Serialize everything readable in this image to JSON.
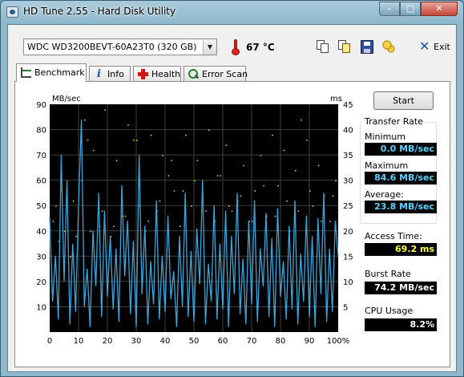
{
  "window": {
    "title": "HD Tune 2.55 - Hard Disk Utility"
  },
  "titlebar": {
    "minimize": "–",
    "maximize": "□",
    "close": "✕"
  },
  "toolbar": {
    "drive": "WDC WD3200BEVT-60A23T0 (320 GB)",
    "temperature": "67 °C",
    "exit_label": "Exit",
    "icons": [
      "copy-text-icon",
      "copy-screenshot-icon",
      "save-icon",
      "options-icon",
      "exit-icon",
      "thermometer-icon"
    ]
  },
  "tabs": [
    {
      "label": "Benchmark",
      "icon": "benchmark-icon",
      "active": true
    },
    {
      "label": "Info",
      "icon": "info-icon",
      "active": false
    },
    {
      "label": "Health",
      "icon": "health-icon",
      "active": false
    },
    {
      "label": "Error Scan",
      "icon": "error-scan-icon",
      "active": false
    }
  ],
  "benchmark": {
    "start_label": "Start",
    "transfer_rate_title": "Transfer Rate",
    "minimum_label": "Minimum",
    "minimum_value": "0.0 MB/sec",
    "maximum_label": "Maximum",
    "maximum_value": "84.6 MB/sec",
    "average_label": "Average:",
    "average_value": "23.8 MB/sec",
    "access_time_label": "Access Time:",
    "access_time_value": "69.2 ms",
    "burst_rate_label": "Burst Rate",
    "burst_rate_value": "74.2 MB/sec",
    "cpu_usage_label": "CPU Usage",
    "cpu_usage_value": "8.2%"
  },
  "colors": {
    "transfer_line": "#3aa6dc",
    "access_points": "#e6e64a",
    "grid": "#3f3f3f",
    "background": "#000000"
  },
  "chart_data": {
    "type": "line",
    "title": "",
    "y_left_label": "MB/sec",
    "y_right_label": "ms",
    "x_ticks": [
      "0",
      "10",
      "20",
      "30",
      "40",
      "50",
      "60",
      "70",
      "80",
      "90",
      "100%"
    ],
    "y_left_ticks": [
      "90",
      "80",
      "70",
      "60",
      "50",
      "40",
      "30",
      "20",
      "10"
    ],
    "y_right_ticks": [
      "45",
      "40",
      "35",
      "30",
      "25",
      "20",
      "15",
      "10",
      "5"
    ],
    "xlim": [
      0,
      100
    ],
    "ylim_left": [
      0,
      90
    ],
    "ylim_right": [
      0,
      45
    ],
    "grid": true,
    "series": [
      {
        "name": "",
        "axis": "left",
        "x": [
          0,
          1,
          2,
          3,
          4,
          5,
          6,
          7,
          8,
          9,
          10,
          11,
          12,
          13,
          14,
          15,
          16,
          17,
          18,
          19,
          20,
          21,
          22,
          23,
          24,
          25,
          26,
          27,
          28,
          29,
          30,
          31,
          32,
          33,
          34,
          35,
          36,
          37,
          38,
          39,
          40,
          41,
          42,
          43,
          44,
          45,
          46,
          47,
          48,
          49,
          50,
          51,
          52,
          53,
          54,
          55,
          56,
          57,
          58,
          59,
          60,
          61,
          62,
          63,
          64,
          65,
          66,
          67,
          68,
          69,
          70,
          71,
          72,
          73,
          74,
          75,
          76,
          77,
          78,
          79,
          80,
          81,
          82,
          83,
          84,
          85,
          86,
          87,
          88,
          89,
          90,
          91,
          92,
          93,
          94,
          95,
          96,
          97,
          98,
          99,
          100
        ],
        "y": [
          45,
          12,
          30,
          5,
          70,
          20,
          60,
          3,
          35,
          8,
          50,
          84,
          10,
          25,
          2,
          40,
          18,
          55,
          6,
          48,
          14,
          38,
          9,
          33,
          4,
          58,
          22,
          44,
          7,
          36,
          2,
          70,
          15,
          42,
          3,
          28,
          11,
          52,
          5,
          30,
          8,
          46,
          13,
          24,
          2,
          38,
          10,
          55,
          6,
          32,
          4,
          41,
          19,
          60,
          3,
          27,
          12,
          50,
          5,
          35,
          9,
          48,
          2,
          38,
          15,
          55,
          7,
          29,
          3,
          44,
          11,
          52,
          4,
          33,
          18,
          47,
          6,
          37,
          2,
          49,
          14,
          28,
          5,
          42,
          9,
          52,
          3,
          31,
          12,
          46,
          6,
          38,
          2,
          45,
          15,
          55,
          4,
          33,
          8,
          44,
          30
        ]
      },
      {
        "name": "",
        "axis": "right",
        "type": "scatter",
        "x": [
          1,
          2,
          3,
          4,
          5,
          6,
          7,
          8,
          9,
          11,
          12,
          13,
          15,
          17,
          19,
          21,
          23,
          25,
          27,
          29,
          31,
          33,
          35,
          37,
          39,
          41,
          43,
          45,
          47,
          49,
          51,
          53,
          55,
          57,
          59,
          61,
          63,
          65,
          67,
          69,
          71,
          73,
          75,
          77,
          79,
          81,
          83,
          85,
          87,
          89,
          91,
          93,
          95,
          97,
          99,
          14,
          18,
          22,
          26,
          30,
          34,
          38,
          42,
          46,
          50,
          54,
          58,
          62,
          66,
          70,
          74,
          78,
          82,
          86,
          90,
          94,
          98
        ],
        "y": [
          22,
          25,
          18,
          28,
          20,
          24,
          15,
          26,
          19,
          30,
          42,
          38,
          36,
          21,
          44,
          19,
          34,
          23,
          41,
          38,
          25,
          20,
          39,
          24,
          35,
          31,
          28,
          21,
          39,
          25,
          34,
          24,
          40,
          22,
          31,
          37,
          24,
          26,
          33,
          22,
          28,
          35,
          23,
          39,
          29,
          36,
          20,
          32,
          42,
          38,
          25,
          33,
          27,
          22,
          30,
          20,
          24,
          21,
          23,
          38,
          22,
          26,
          34,
          28,
          30,
          24,
          31,
          25,
          27,
          22,
          29,
          23,
          26,
          24,
          28,
          22,
          27
        ]
      }
    ]
  }
}
